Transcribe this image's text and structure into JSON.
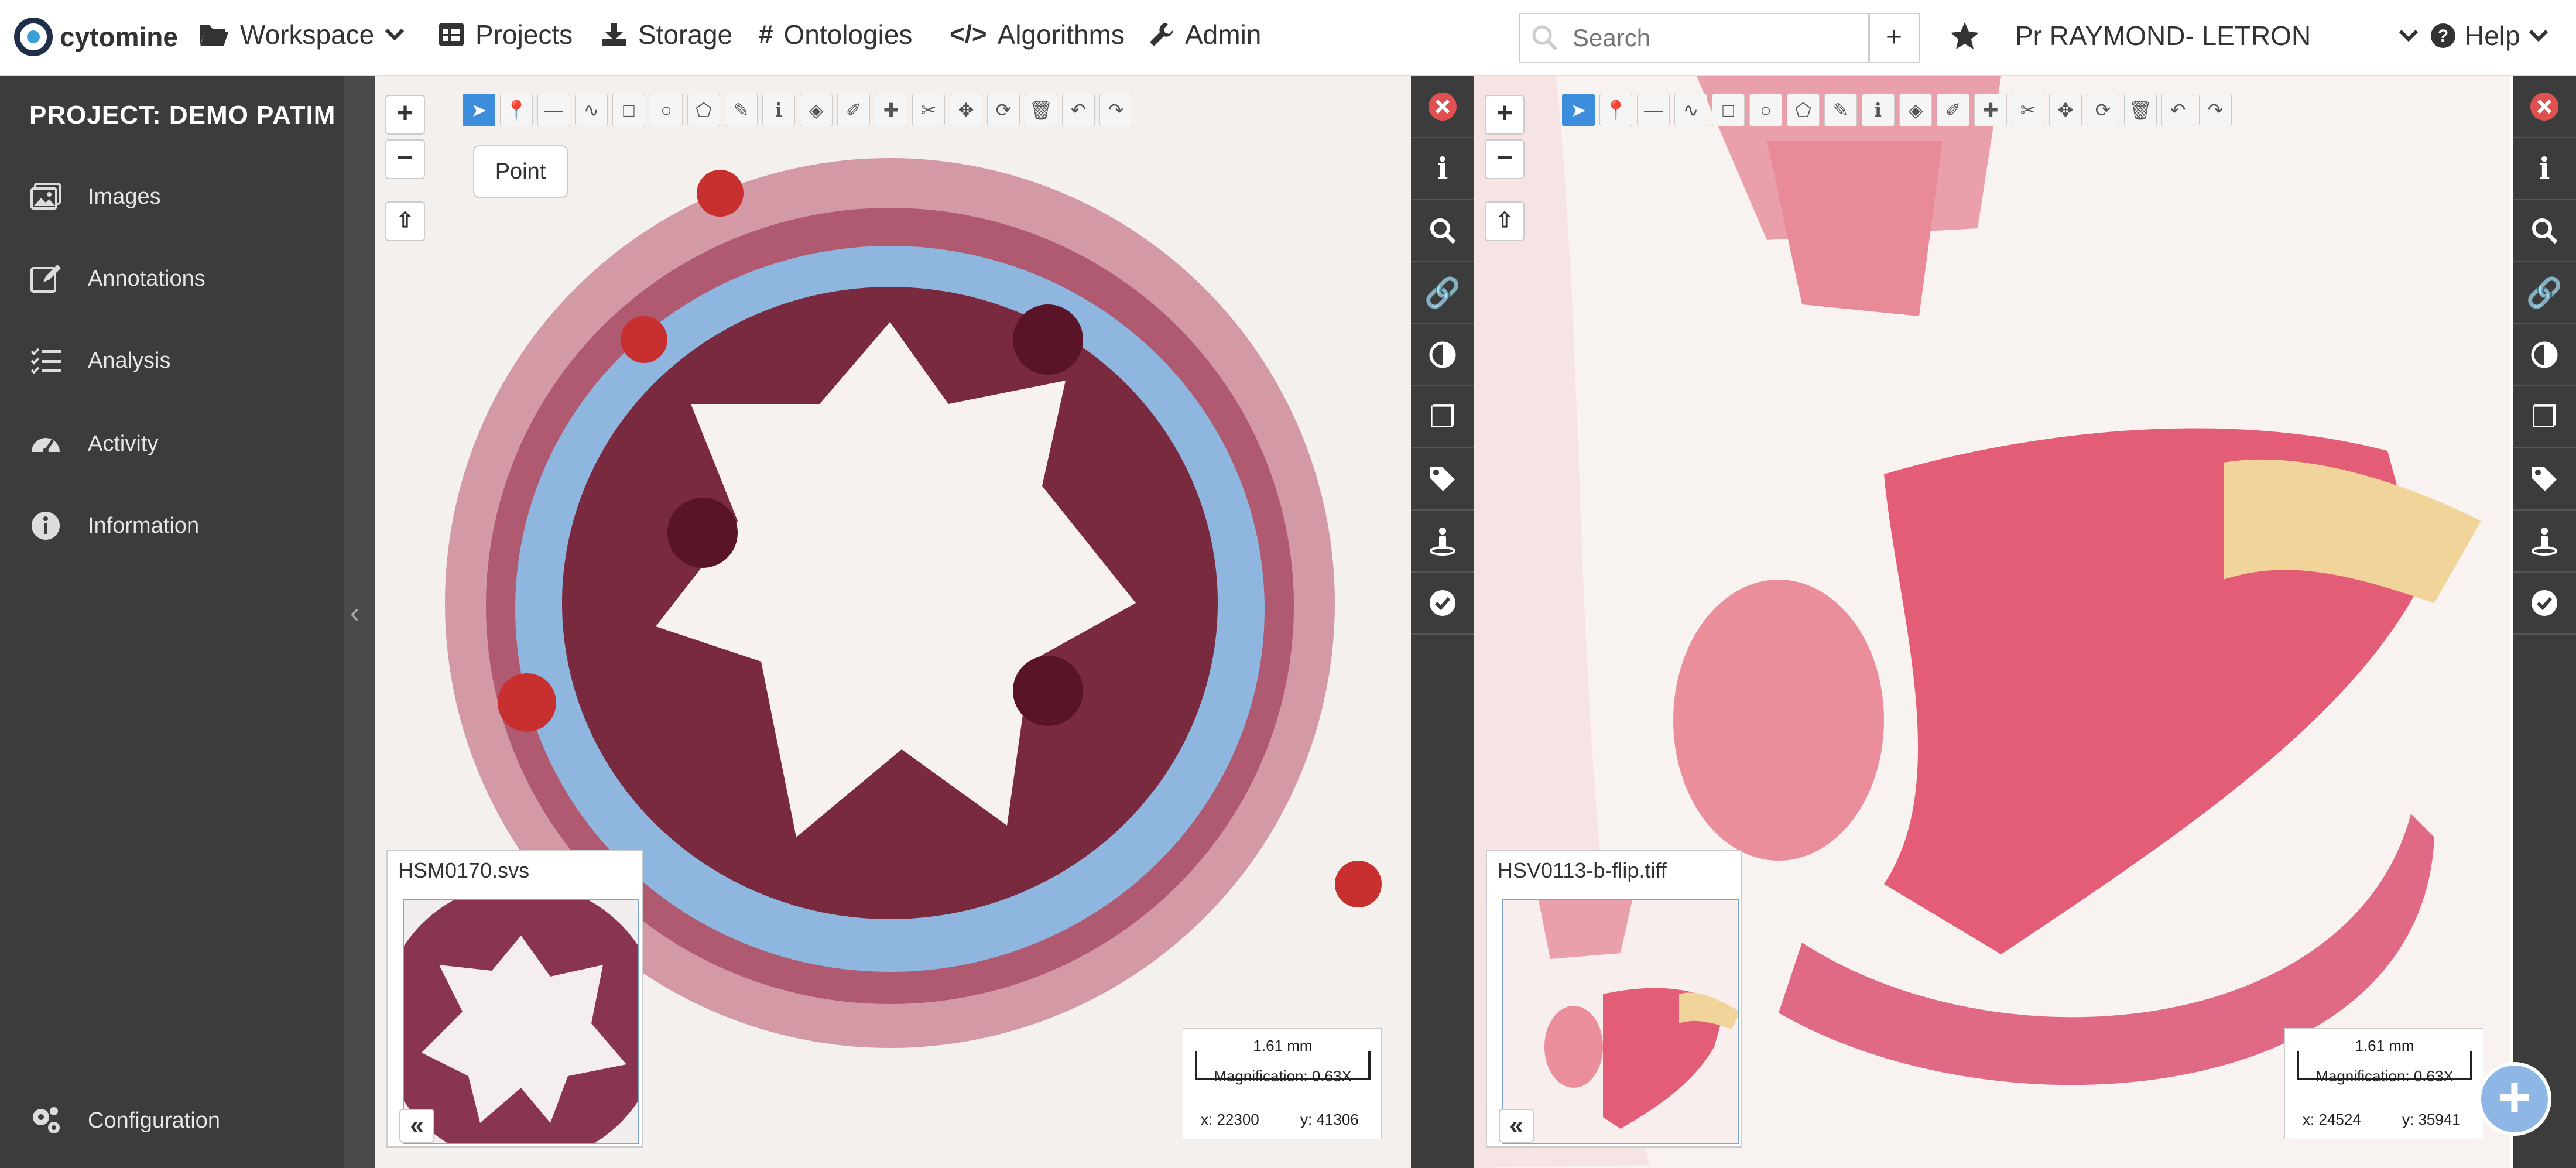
{
  "app": {
    "name": "cytomine"
  },
  "nav": {
    "workspace": "Workspace",
    "projects": "Projects",
    "storage": "Storage",
    "ontologies": "Ontologies",
    "algorithms": "Algorithms",
    "admin": "Admin"
  },
  "search": {
    "placeholder": "Search",
    "add_label": "+"
  },
  "user": {
    "name": "Pr RAYMOND- LETRON"
  },
  "help": {
    "label": "Help"
  },
  "sidebar": {
    "project_title": "PROJECT: DEMO PATIM",
    "items": [
      {
        "label": "Images",
        "icon": "images-icon"
      },
      {
        "label": "Annotations",
        "icon": "edit-icon"
      },
      {
        "label": "Analysis",
        "icon": "list-icon"
      },
      {
        "label": "Activity",
        "icon": "gauge-icon"
      },
      {
        "label": "Information",
        "icon": "info-icon"
      }
    ],
    "configuration": "Configuration"
  },
  "viewers": [
    {
      "image_name": "HSM0170.svs",
      "tooltip": "Point",
      "scale_length": "1.61 mm",
      "magnification": "Magnification: 0.63X",
      "x": "x: 22300",
      "y": "y: 41306"
    },
    {
      "image_name": "HSV0113-b-flip.tiff",
      "scale_length": "1.61 mm",
      "magnification": "Magnification: 0.63X",
      "x": "x: 24524",
      "y": "y: 35941"
    }
  ],
  "zoom": {
    "in": "+",
    "out": "−"
  },
  "overview": {
    "collapse": "«"
  },
  "colors": {
    "sidebar": "#3c3c3c",
    "accent": "#3c8ddb",
    "close": "#e05050"
  }
}
